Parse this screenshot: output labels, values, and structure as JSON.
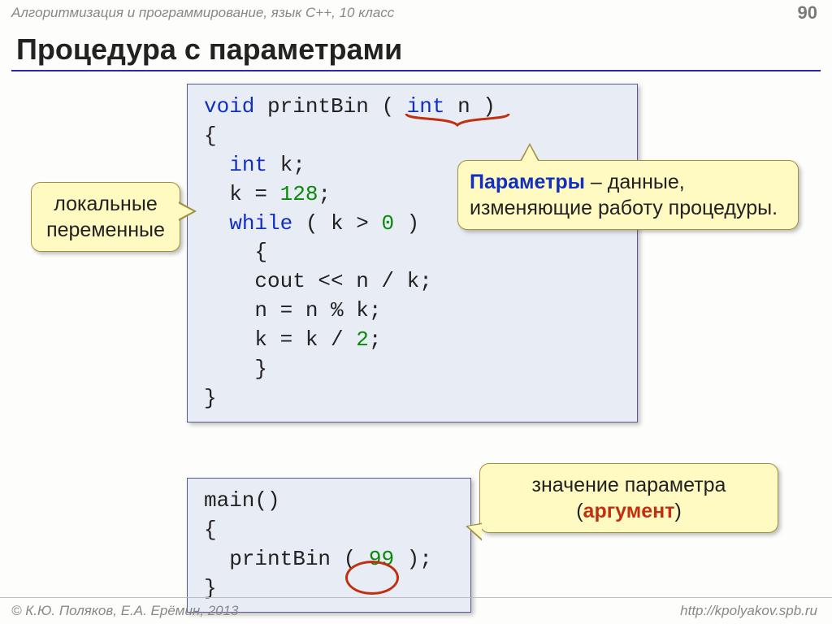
{
  "header": {
    "breadcrumb": "Алгоритмизация и программирование, язык  C++, 10 класс",
    "page": "90"
  },
  "title": "Процедура с параметрами",
  "code1": {
    "l1a": "void",
    "l1b": " printBin ( ",
    "l1c": "int",
    "l1d": " n )",
    "l2": "{",
    "l3a": "  ",
    "l3b": "int",
    "l3c": " k;",
    "l4a": "  k = ",
    "l4b": "128",
    "l4c": ";",
    "l5a": "  ",
    "l5b": "while",
    "l5c": " ( k > ",
    "l5d": "0",
    "l5e": " )",
    "l6": "    {",
    "l7": "    cout << n / k;",
    "l8": "    n = n % k;",
    "l9a": "    k = k / ",
    "l9b": "2",
    "l9c": ";",
    "l10": "    }",
    "l11": "}"
  },
  "code2": {
    "l1": "main()",
    "l2": "{",
    "l3a": "  printBin ( ",
    "l3b": "99",
    "l3c": " );",
    "l4": "}"
  },
  "callouts": {
    "local": "локальные переменные",
    "param_hl": "Параметры",
    "param_rest": " – данные, изменяющие работу процедуры.",
    "arg_pre": "значение параметра (",
    "arg_hl": "аргумент",
    "arg_post": ")"
  },
  "footer": {
    "left": "© К.Ю. Поляков, Е.А. Ерёмин, 2013",
    "right": "http://kpolyakov.spb.ru"
  }
}
